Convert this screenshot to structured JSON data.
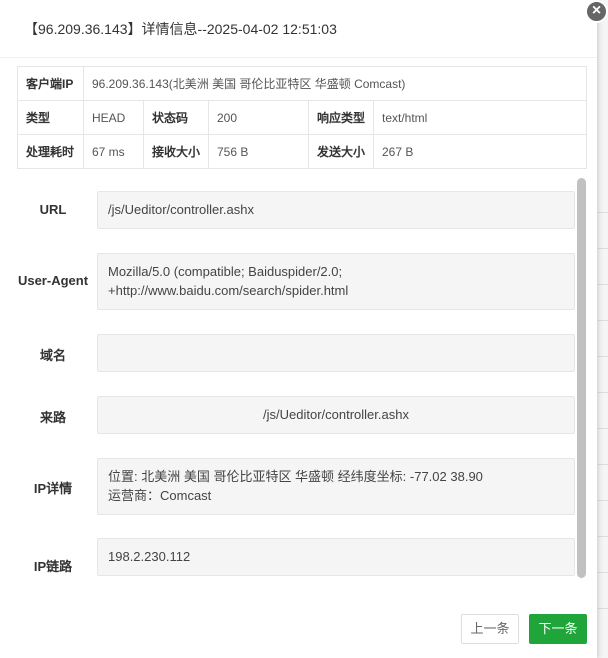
{
  "dialog": {
    "title": "【96.209.36.143】详情信息--2025-04-02 12:51:03",
    "close_label": "×"
  },
  "summary": {
    "client_ip_label": "客户端IP",
    "client_ip_value": "96.209.36.143(北美洲 美国 哥伦比亚特区 华盛顿 Comcast)",
    "type_label": "类型",
    "type_value": "HEAD",
    "status_label": "状态码",
    "status_value": "200",
    "resp_type_label": "响应类型",
    "resp_type_value": "text/html",
    "proc_time_label": "处理耗时",
    "proc_time_value": "67 ms",
    "recv_size_label": "接收大小",
    "recv_size_value": "756 B",
    "send_size_label": "发送大小",
    "send_size_value": "267 B"
  },
  "details": {
    "url_label": "URL",
    "url_value": "/js/Ueditor/controller.ashx",
    "ua_label": "User-Agent",
    "ua_value": "Mozilla/5.0 (compatible; Baiduspider/2.0; +http://www.baidu.com/search/spider.html",
    "domain_label": "域名",
    "domain_value": "",
    "referer_label": "来路",
    "referer_value": "/js/Ueditor/controller.ashx",
    "ip_detail_label": "IP详情",
    "ip_location": "位置: 北美洲 美国 哥伦比亚特区 华盛顿 经纬度坐标: -77.02 38.90",
    "ip_isp": "运营商：Comcast",
    "ip_chain_label": "IP链路",
    "ip_chain_value": "198.2.230.112"
  },
  "footer": {
    "prev_label": "上一条",
    "next_label": "下一条"
  }
}
